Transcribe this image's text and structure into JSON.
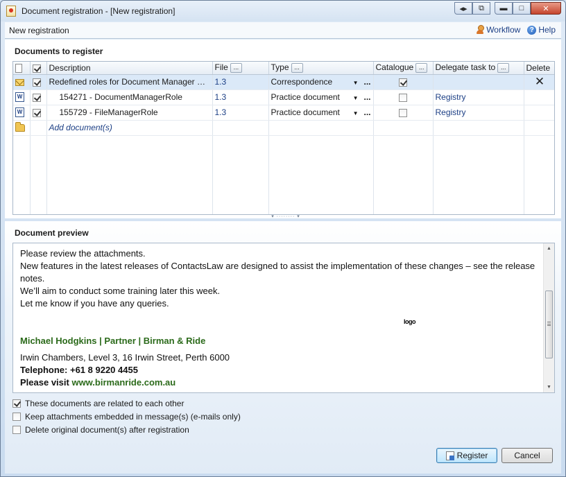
{
  "window": {
    "title": "Document registration - [New registration]",
    "controls": {
      "swap": "◂▸",
      "restore_alt": "⧉",
      "minimize": "▬",
      "maximize": "□",
      "close": "✕"
    }
  },
  "toolbar": {
    "mode_label": "New registration",
    "workflow_label": "Workflow",
    "help_label": "Help",
    "icons": {
      "workflow": "person-icon",
      "help": "help-icon"
    }
  },
  "documents": {
    "section_title": "Documents to register",
    "columns": {
      "description": "Description",
      "file": "File",
      "type": "Type",
      "catalogue": "Catalogue",
      "delegate": "Delegate task to",
      "delete": "Delete",
      "header_button": "..."
    },
    "rows": [
      {
        "icon": "mail-icon",
        "checked": true,
        "description": "Redefined roles for Document Manager an...",
        "file": "1.3",
        "type": "Correspondence",
        "catalogue": true,
        "delegate": "",
        "delete": "✕",
        "selected": true
      },
      {
        "icon": "word-icon",
        "checked": true,
        "description": "154271 - DocumentManagerRole",
        "file": "1.3",
        "type": "Practice document",
        "catalogue": false,
        "delegate": "Registry",
        "delete": "",
        "selected": false
      },
      {
        "icon": "word-icon",
        "checked": true,
        "description": "155729 - FileManagerRole",
        "file": "1.3",
        "type": "Practice document",
        "catalogue": false,
        "delegate": "Registry",
        "delete": "",
        "selected": false
      }
    ],
    "add_label": "Add document(s)",
    "dropdown_arrow": "▼",
    "dropdown_more": "...",
    "word_icon_letter": "W"
  },
  "preview": {
    "section_title": "Document preview",
    "lines": [
      "Please review the attachments.",
      "New features in the latest releases of ContactsLaw are designed to assist the implementation of these changes – see the release notes.",
      "We’ll aim to conduct some training later this week.",
      "Let me know if you have any queries."
    ],
    "logo_text": "logo",
    "signature_name": "Michael Hodgkins  |  Partner  |  Birman & Ride",
    "address": "Irwin Chambers, Level 3, 16 Irwin Street, Perth 6000",
    "telephone": "Telephone: +61 8 9220 4455",
    "visit_label": "Please visit ",
    "visit_url": "www.birmanride.com.au",
    "scroll": {
      "up": "▲",
      "down": "▼"
    }
  },
  "options": [
    {
      "label": "These documents are related to each other",
      "checked": true
    },
    {
      "label": "Keep attachments embedded in message(s) (e-mails only)",
      "checked": false
    },
    {
      "label": "Delete original document(s) after registration",
      "checked": false
    }
  ],
  "buttons": {
    "register": "Register",
    "cancel": "Cancel"
  },
  "splitter_glyph": "▾ ········ ▾"
}
